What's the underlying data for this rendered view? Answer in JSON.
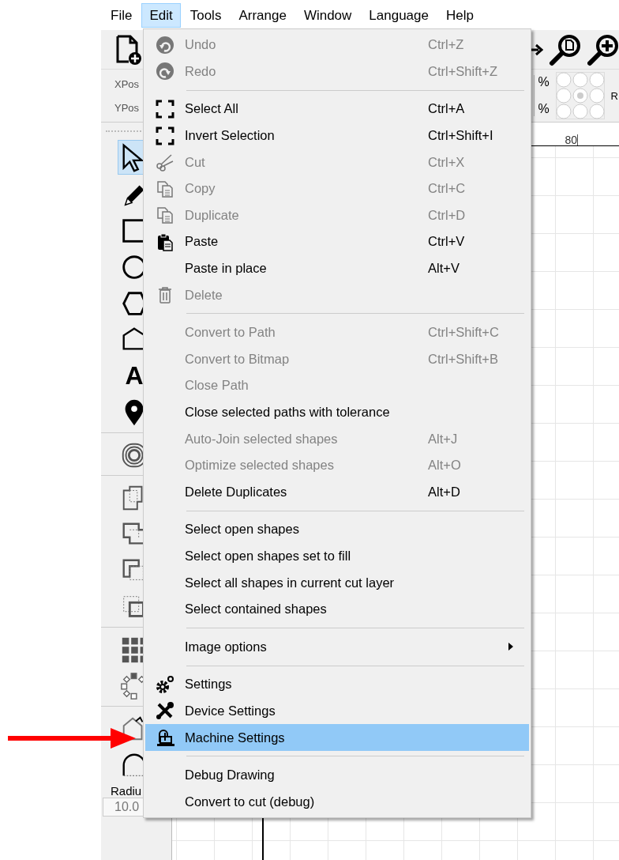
{
  "menubar": {
    "items": [
      {
        "label": "File",
        "selected": false
      },
      {
        "label": "Edit",
        "selected": true
      },
      {
        "label": "Tools",
        "selected": false
      },
      {
        "label": "Arrange",
        "selected": false
      },
      {
        "label": "Window",
        "selected": false
      },
      {
        "label": "Language",
        "selected": false
      },
      {
        "label": "Help",
        "selected": false
      }
    ]
  },
  "position_bar": {
    "labels": [
      "XPos",
      "YPos"
    ],
    "units": [
      "%",
      "%"
    ],
    "side_label": "R"
  },
  "tool_panel": {
    "groups": [
      [
        {
          "kind": "select",
          "selected": true
        },
        {
          "kind": "pencil",
          "selected": false
        },
        {
          "kind": "rect",
          "selected": false
        },
        {
          "kind": "circle",
          "selected": false
        },
        {
          "kind": "hexagon",
          "selected": false
        },
        {
          "kind": "polygon",
          "selected": false
        },
        {
          "kind": "text",
          "glyph": "A",
          "selected": false
        },
        {
          "kind": "pin",
          "selected": false
        }
      ],
      [
        {
          "kind": "offset",
          "selected": false
        }
      ],
      [
        {
          "kind": "union",
          "selected": false
        },
        {
          "kind": "subtract",
          "selected": false
        },
        {
          "kind": "intersect",
          "selected": false
        },
        {
          "kind": "xor",
          "selected": false
        }
      ],
      [
        {
          "kind": "grid",
          "selected": false
        },
        {
          "kind": "ring",
          "selected": false
        }
      ],
      [
        {
          "kind": "direction",
          "selected": false
        },
        {
          "kind": "arc",
          "selected": false
        }
      ]
    ],
    "radius_label": "Radiu",
    "radius_value": "10.0"
  },
  "canvas": {
    "ruler_labels": [
      "80"
    ]
  },
  "edit_menu": {
    "items": [
      {
        "kind": "item",
        "label": "Undo",
        "shortcut": "Ctrl+Z",
        "disabled": true,
        "selected": false
      },
      {
        "kind": "item",
        "label": "Redo",
        "shortcut": "Ctrl+Shift+Z",
        "disabled": true,
        "selected": false
      },
      {
        "kind": "separator"
      },
      {
        "kind": "item",
        "label": "Select All",
        "shortcut": "Ctrl+A",
        "disabled": false,
        "selected": false
      },
      {
        "kind": "item",
        "label": "Invert Selection",
        "shortcut": "Ctrl+Shift+I",
        "disabled": false,
        "selected": false
      },
      {
        "kind": "item",
        "label": "Cut",
        "shortcut": "Ctrl+X",
        "disabled": true,
        "selected": false
      },
      {
        "kind": "item",
        "label": "Copy",
        "shortcut": "Ctrl+C",
        "disabled": true,
        "selected": false
      },
      {
        "kind": "item",
        "label": "Duplicate",
        "shortcut": "Ctrl+D",
        "disabled": true,
        "selected": false
      },
      {
        "kind": "item",
        "label": "Paste",
        "shortcut": "Ctrl+V",
        "disabled": false,
        "selected": false
      },
      {
        "kind": "item",
        "label": "Paste in place",
        "shortcut": "Alt+V",
        "disabled": false,
        "selected": false
      },
      {
        "kind": "item",
        "label": "Delete",
        "disabled": true,
        "selected": false
      },
      {
        "kind": "separator"
      },
      {
        "kind": "item",
        "label": "Convert to Path",
        "shortcut": "Ctrl+Shift+C",
        "disabled": true,
        "selected": false
      },
      {
        "kind": "item",
        "label": "Convert to Bitmap",
        "shortcut": "Ctrl+Shift+B",
        "disabled": true,
        "selected": false
      },
      {
        "kind": "item",
        "label": "Close Path",
        "disabled": true,
        "selected": false
      },
      {
        "kind": "item",
        "label": "Close selected paths with tolerance",
        "disabled": false,
        "selected": false
      },
      {
        "kind": "item",
        "label": "Auto-Join selected shapes",
        "shortcut": "Alt+J",
        "disabled": true,
        "selected": false
      },
      {
        "kind": "item",
        "label": "Optimize selected shapes",
        "shortcut": "Alt+O",
        "disabled": true,
        "selected": false
      },
      {
        "kind": "item",
        "label": "Delete Duplicates",
        "shortcut": "Alt+D",
        "disabled": false,
        "selected": false
      },
      {
        "kind": "separator"
      },
      {
        "kind": "item",
        "label": "Select open shapes",
        "disabled": false,
        "selected": false
      },
      {
        "kind": "item",
        "label": "Select open shapes set to fill",
        "disabled": false,
        "selected": false
      },
      {
        "kind": "item",
        "label": "Select all shapes in current cut layer",
        "disabled": false,
        "selected": false
      },
      {
        "kind": "item",
        "label": "Select contained shapes",
        "disabled": false,
        "selected": false
      },
      {
        "kind": "separator"
      },
      {
        "kind": "submenu",
        "label": "Image options",
        "disabled": false,
        "selected": false
      },
      {
        "kind": "separator"
      },
      {
        "kind": "item",
        "label": "Settings",
        "disabled": false,
        "selected": false
      },
      {
        "kind": "item",
        "label": "Device Settings",
        "disabled": false,
        "selected": false
      },
      {
        "kind": "item",
        "label": "Machine Settings",
        "disabled": false,
        "selected": true
      },
      {
        "kind": "separator"
      },
      {
        "kind": "item",
        "label": "Debug Drawing",
        "disabled": false,
        "selected": false
      },
      {
        "kind": "item",
        "label": "Convert to cut (debug)",
        "disabled": false,
        "selected": false
      }
    ]
  }
}
